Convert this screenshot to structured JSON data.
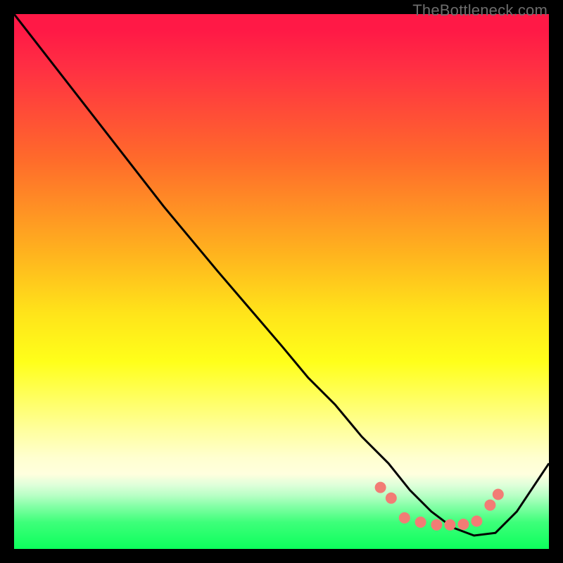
{
  "watermark": "TheBottleneck.com",
  "chart_data": {
    "type": "line",
    "title": "",
    "xlabel": "",
    "ylabel": "",
    "xlim": [
      0,
      100
    ],
    "ylim": [
      0,
      100
    ],
    "curve": {
      "x": [
        0,
        7,
        14,
        21,
        28,
        33,
        38,
        44,
        50,
        55,
        60,
        65,
        70,
        74,
        78,
        82,
        86,
        90,
        94,
        100
      ],
      "y": [
        100,
        91,
        82,
        73,
        64,
        58,
        52,
        45,
        38,
        32,
        27,
        21,
        16,
        11,
        7,
        4,
        2.5,
        3,
        7,
        16
      ]
    },
    "dots": {
      "x": [
        68.5,
        70.5,
        73,
        76,
        79,
        81.5,
        84,
        86.5,
        89,
        90.5
      ],
      "y": [
        11.5,
        9.5,
        5.8,
        5.0,
        4.5,
        4.5,
        4.6,
        5.2,
        8.2,
        10.2
      ],
      "color": "#f27c75",
      "radius": 8
    }
  },
  "colors": {
    "curve_stroke": "#000000",
    "background_frame": "#000000"
  }
}
